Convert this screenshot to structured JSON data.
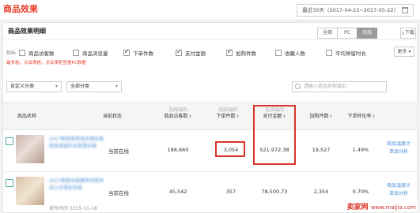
{
  "header": {
    "title": "商品效果",
    "date_range": "最近30天（2017-04-23~2017-05-22）"
  },
  "panel": {
    "title": "商品效果明细",
    "tabs": [
      "全部",
      "PC",
      "无线"
    ],
    "active_tab": "无线",
    "download_label": "下载"
  },
  "metrics": {
    "label": "指标",
    "items": [
      {
        "label": "商品访客数",
        "checked": false
      },
      {
        "label": "商品浏览量",
        "checked": false
      },
      {
        "label": "下单件数",
        "checked": true
      },
      {
        "label": "支付金额",
        "checked": true
      },
      {
        "label": "加购件数",
        "checked": true
      },
      {
        "label": "收藏人数",
        "checked": false
      },
      {
        "label": "平均停留时长",
        "checked": false
      }
    ],
    "hint": "最多选，点击表格，点击掌柜查看PC数据",
    "more_label": "更多"
  },
  "filters": {
    "category": "自定义分类",
    "scope": "全部分类",
    "search_placeholder": "请输入商品名称或ID"
  },
  "table": {
    "headers": {
      "name": "商品名称",
      "status": "当前状态",
      "visitors_sub": "无线端的",
      "visitors": "商品访客数",
      "orders_sub": "无线端的",
      "orders": "下单件数",
      "pay_sub": "无线端的",
      "pay": "支付金额",
      "cart": "加购件数",
      "conv": "下单转化率"
    },
    "rows": [
      {
        "name": "2017新款夏季连衣裙女装修身显瘦中长款雪纺裙",
        "status": "当前在线",
        "visitors": "186,660",
        "orders": "3,054",
        "pay": "521,972.38",
        "cart": "19,527",
        "conv": "1.49%",
        "link1": "商品温度计",
        "link2": "单品分析",
        "date": ""
      },
      {
        "name": "2017新款女装春季百搭休闲上衣宽松显瘦",
        "status": "当前在线",
        "visitors": "45,542",
        "orders": "357",
        "pay": "78,500.73",
        "cart": "2,354",
        "conv": "0.70%",
        "link1": "商品温度计",
        "link2": "单品分析",
        "date": "发布时间  2015-11-18"
      }
    ]
  },
  "watermark": {
    "brand": "卖家网",
    "url": "www.maijia.com"
  },
  "colors": {
    "accent": "#e8402f",
    "highlight": "#d8352a",
    "link": "#4a8fd8"
  }
}
